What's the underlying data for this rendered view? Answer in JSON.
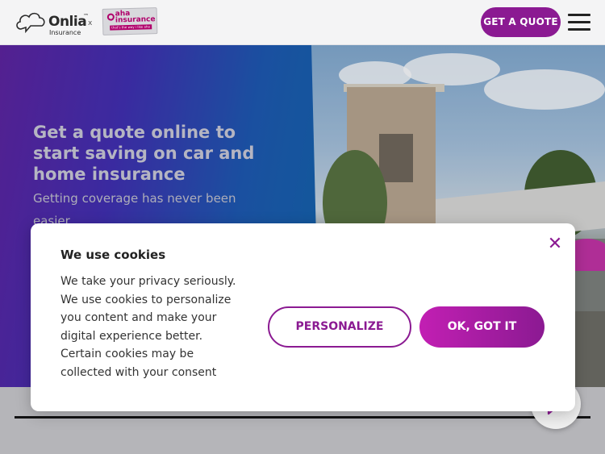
{
  "header": {
    "brand": {
      "name": "Onlia",
      "tm": "™",
      "sub": "Insurance"
    },
    "separator": "x",
    "partner": {
      "name": "aha insurance",
      "tagline": "that's the way i like aha"
    },
    "cta_label": "GET A QUOTE",
    "menu_icon": "hamburger-icon"
  },
  "hero": {
    "title": "Get a quote online to start saving on car and home insurance",
    "subtitle": "Getting coverage has never been easier."
  },
  "cookie_dialog": {
    "title": "We use cookies",
    "body": "We take your privacy seriously. We use cookies to personalize you content and make your digital experience better. Certain cookies may be collected with your consent",
    "close_icon": "close-icon",
    "close_glyph": "✕",
    "personalize_label": "PERSONALIZE",
    "accept_label": "OK, GOT IT"
  },
  "chat": {
    "icon": "chat-icon"
  },
  "colors": {
    "brand_purple": "#8b1a92",
    "accent_magenta": "#c21fb3",
    "hero_gradient_start": "#5a1f9e",
    "hero_gradient_end": "#0e62a8"
  }
}
